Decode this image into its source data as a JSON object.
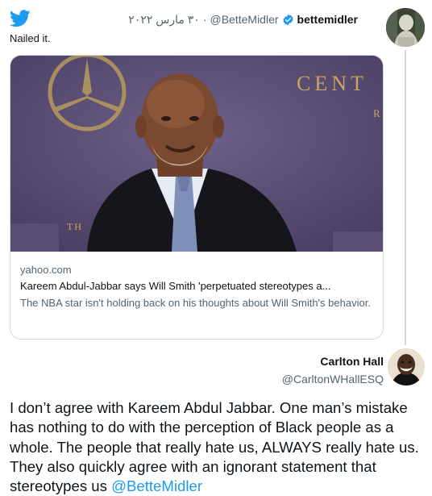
{
  "icons": {
    "logo": "twitter-bird-icon",
    "verified": "verified-badge-icon"
  },
  "colors": {
    "accent": "#1d9bf0",
    "text": "#0f1419",
    "secondary": "#536471",
    "border": "#cfd9de"
  },
  "quoted_tweet": {
    "display_name": "bettemidler",
    "handle": "@BetteMidler",
    "separator": "·",
    "date": "٣٠ مارس ٢٠٢٢",
    "text": "Nailed it.",
    "card": {
      "domain": "yahoo.com",
      "title": "Kareem Abdul-Jabbar says Will Smith 'perpetuated stereotypes a...",
      "description": "The NBA star isn't holding back on his thoughts about Will Smith's behavior.",
      "image_text": {
        "right": "CENT",
        "right_small": "R",
        "left_small": "TH"
      }
    }
  },
  "reply_tweet": {
    "display_name": "Carlton Hall",
    "handle": "@CarltonWHallESQ",
    "text": "I don’t agree with Kareem Abdul Jabbar. One man’s mistake has nothing to do with the perception of Black people as a whole. The people that really hate us, ALWAYS really hate us. They also quickly agree with an ignorant statement that stereotypes us ",
    "mention": "@BetteMidler"
  }
}
